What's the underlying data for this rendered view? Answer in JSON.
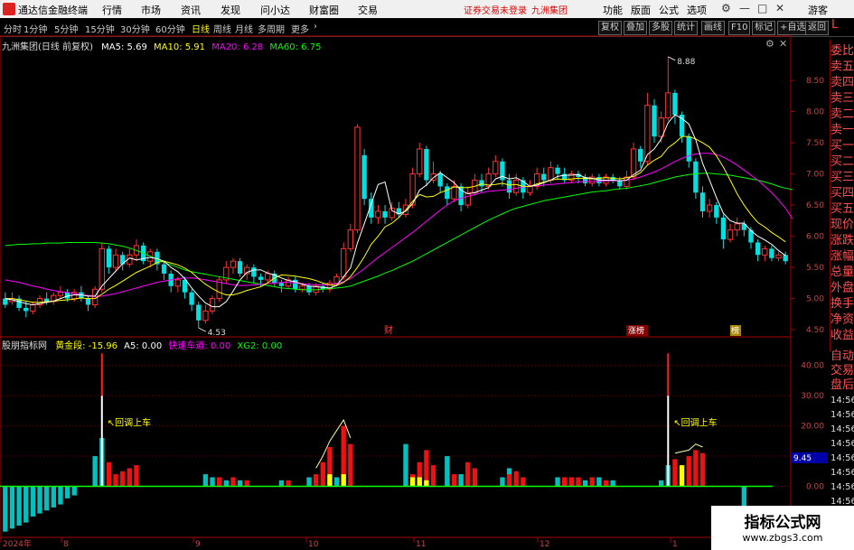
{
  "app": {
    "title": "通达信金融终端",
    "login_warning": "证券交易未登录",
    "stock_name": "九洲集团"
  },
  "menu": {
    "items": [
      "行情",
      "市场",
      "资讯",
      "发现",
      "问小达",
      "财富圈",
      "交易"
    ],
    "right": [
      "功能",
      "版面",
      "公式",
      "选项"
    ],
    "guest": "游客"
  },
  "toolbar": {
    "periods": [
      "分时",
      "1分钟",
      "5分钟",
      "15分钟",
      "30分钟",
      "60分钟",
      "日线",
      "周线",
      "月线",
      "多周期",
      "更多"
    ],
    "active": "日线",
    "right_buttons": [
      "复权",
      "叠加",
      "多股",
      "统计",
      "画线",
      "F10",
      "标记",
      "+自选",
      "返回"
    ]
  },
  "main_legend": {
    "stock": "九洲集团(日线 前复权)",
    "ma5": "MA5: 5.69",
    "ma10": "MA10: 5.91",
    "ma20": "MA20: 6.28",
    "ma60": "MA60: 6.75"
  },
  "sub_legend": {
    "name": "股朋指标网",
    "gold": "黄金段: -15.96",
    "a5": "A5: 0.00",
    "fast": "快速车道: 0.00",
    "xg2": "XG2: 0.00"
  },
  "side_panel": {
    "items": [
      "委比",
      "卖五",
      "卖四",
      "卖三",
      "卖二",
      "卖一",
      "买一",
      "买二",
      "买三",
      "买四",
      "买五",
      "现价",
      "涨跌",
      "涨幅",
      "总量",
      "外盘",
      "换手",
      "净资",
      "收益"
    ],
    "marker": "L"
  },
  "side_panel2": {
    "items": [
      "自动",
      "交易",
      "盘后",
      "14:56",
      "14:56",
      "14:56",
      "14:56",
      "14:56",
      "14:56",
      "14:56",
      "14:56",
      "14:56"
    ]
  },
  "price_axis": [
    "8.50",
    "8.00",
    "7.50",
    "7.00",
    "6.50",
    "6.00",
    "5.50",
    "5.00",
    "4.50"
  ],
  "sub_axis": [
    "40.00",
    "30.00",
    "20.00",
    "10.00",
    "0.00"
  ],
  "sub_marker": "9.45",
  "date_axis": [
    "2024年",
    "8",
    "9",
    "10",
    "11",
    "12",
    "1"
  ],
  "annotations": {
    "high": "8.88",
    "low": "4.53",
    "signal": "回调上车",
    "tag_cai": "财",
    "tag_zt": "涨榜",
    "tag_ban": "榜"
  },
  "watermark": {
    "line1": "指标公式网",
    "line2": "www.zbgs3.com"
  },
  "colors": {
    "up": "#ff3333",
    "down": "#00e0e0",
    "ma5": "#ffffff",
    "ma10": "#ffff00",
    "ma20": "#ff00ff",
    "ma60": "#00ff00"
  },
  "chart_data": {
    "type": "candlestick",
    "ylim": [
      4.4,
      8.95
    ],
    "candles": [
      [
        5.0,
        4.9,
        5.1,
        4.85
      ],
      [
        4.95,
        5.0,
        5.1,
        4.9
      ],
      [
        5.0,
        4.85,
        5.05,
        4.8
      ],
      [
        4.85,
        4.8,
        4.95,
        4.7
      ],
      [
        4.8,
        4.9,
        4.95,
        4.75
      ],
      [
        4.9,
        5.0,
        5.05,
        4.85
      ],
      [
        5.0,
        4.95,
        5.1,
        4.9
      ],
      [
        4.95,
        5.05,
        5.1,
        4.9
      ],
      [
        5.05,
        5.1,
        5.2,
        5.0
      ],
      [
        5.1,
        5.0,
        5.15,
        4.95
      ],
      [
        5.0,
        5.1,
        5.15,
        4.95
      ],
      [
        5.1,
        5.0,
        5.2,
        4.95
      ],
      [
        5.0,
        4.9,
        5.05,
        4.8
      ],
      [
        4.9,
        5.15,
        5.2,
        4.85
      ],
      [
        5.15,
        5.8,
        5.9,
        5.1
      ],
      [
        5.8,
        5.5,
        5.85,
        5.4
      ],
      [
        5.5,
        5.7,
        5.8,
        5.45
      ],
      [
        5.7,
        5.55,
        5.75,
        5.45
      ],
      [
        5.55,
        5.7,
        5.8,
        5.5
      ],
      [
        5.7,
        5.85,
        5.95,
        5.6
      ],
      [
        5.85,
        5.6,
        5.9,
        5.55
      ],
      [
        5.6,
        5.75,
        5.8,
        5.5
      ],
      [
        5.75,
        5.55,
        5.8,
        5.45
      ],
      [
        5.55,
        5.4,
        5.6,
        5.3
      ],
      [
        5.4,
        5.2,
        5.45,
        5.1
      ],
      [
        5.2,
        5.3,
        5.35,
        5.1
      ],
      [
        5.3,
        5.1,
        5.35,
        5.0
      ],
      [
        5.1,
        4.9,
        5.15,
        4.8
      ],
      [
        4.9,
        4.65,
        4.95,
        4.53
      ],
      [
        4.65,
        4.8,
        4.9,
        4.6
      ],
      [
        4.8,
        5.0,
        5.05,
        4.75
      ],
      [
        5.0,
        5.3,
        5.35,
        4.95
      ],
      [
        5.3,
        5.5,
        5.6,
        5.25
      ],
      [
        5.5,
        5.6,
        5.65,
        5.4
      ],
      [
        5.6,
        5.4,
        5.65,
        5.35
      ],
      [
        5.4,
        5.5,
        5.55,
        5.3
      ],
      [
        5.5,
        5.35,
        5.55,
        5.25
      ],
      [
        5.35,
        5.3,
        5.4,
        5.2
      ],
      [
        5.3,
        5.4,
        5.45,
        5.25
      ],
      [
        5.4,
        5.25,
        5.45,
        5.2
      ],
      [
        5.25,
        5.2,
        5.3,
        5.1
      ],
      [
        5.2,
        5.3,
        5.35,
        5.15
      ],
      [
        5.3,
        5.15,
        5.35,
        5.1
      ],
      [
        5.15,
        5.2,
        5.25,
        5.1
      ],
      [
        5.2,
        5.1,
        5.25,
        5.05
      ],
      [
        5.1,
        5.2,
        5.25,
        5.05
      ],
      [
        5.2,
        5.15,
        5.25,
        5.1
      ],
      [
        5.15,
        5.25,
        5.3,
        5.1
      ],
      [
        5.25,
        5.35,
        5.4,
        5.2
      ],
      [
        5.35,
        5.8,
        5.9,
        5.3
      ],
      [
        5.8,
        6.1,
        6.2,
        5.75
      ],
      [
        6.1,
        7.75,
        7.8,
        6.05
      ],
      [
        7.3,
        6.6,
        7.4,
        6.5
      ],
      [
        6.6,
        6.3,
        6.7,
        6.2
      ],
      [
        6.3,
        6.4,
        6.5,
        6.2
      ],
      [
        6.4,
        6.3,
        6.5,
        6.2
      ],
      [
        6.3,
        6.45,
        6.55,
        6.25
      ],
      [
        6.45,
        6.35,
        6.55,
        6.3
      ],
      [
        6.35,
        6.5,
        6.6,
        6.3
      ],
      [
        6.5,
        7.0,
        7.1,
        6.45
      ],
      [
        7.0,
        7.4,
        7.5,
        6.95
      ],
      [
        7.4,
        6.9,
        7.45,
        6.8
      ],
      [
        6.9,
        7.0,
        7.2,
        6.85
      ],
      [
        7.0,
        6.8,
        7.05,
        6.7
      ],
      [
        6.8,
        6.6,
        6.85,
        6.5
      ],
      [
        6.6,
        6.8,
        6.9,
        6.55
      ],
      [
        6.8,
        6.5,
        6.85,
        6.4
      ],
      [
        6.5,
        6.7,
        6.8,
        6.45
      ],
      [
        6.7,
        6.9,
        7.0,
        6.65
      ],
      [
        6.9,
        6.8,
        7.0,
        6.7
      ],
      [
        6.8,
        7.0,
        7.1,
        6.75
      ],
      [
        7.0,
        7.2,
        7.3,
        6.95
      ],
      [
        7.2,
        6.9,
        7.25,
        6.8
      ],
      [
        6.9,
        6.7,
        7.0,
        6.6
      ],
      [
        6.7,
        6.9,
        7.0,
        6.65
      ],
      [
        6.9,
        6.7,
        6.95,
        6.6
      ],
      [
        6.7,
        6.8,
        6.9,
        6.65
      ],
      [
        6.8,
        7.0,
        7.1,
        6.75
      ],
      [
        7.0,
        6.9,
        7.1,
        6.8
      ],
      [
        6.9,
        7.1,
        7.2,
        6.85
      ],
      [
        7.1,
        7.0,
        7.15,
        6.9
      ],
      [
        7.0,
        6.9,
        7.1,
        6.85
      ],
      [
        6.9,
        7.0,
        7.05,
        6.85
      ],
      [
        7.0,
        6.95,
        7.05,
        6.85
      ],
      [
        6.95,
        6.85,
        7.0,
        6.8
      ],
      [
        6.85,
        6.95,
        7.0,
        6.8
      ],
      [
        6.95,
        6.85,
        7.0,
        6.8
      ],
      [
        6.85,
        6.95,
        7.0,
        6.8
      ],
      [
        6.95,
        6.9,
        7.0,
        6.85
      ],
      [
        6.9,
        6.8,
        6.95,
        6.75
      ],
      [
        6.8,
        6.95,
        7.05,
        6.75
      ],
      [
        6.95,
        7.4,
        7.5,
        6.9
      ],
      [
        7.4,
        7.2,
        7.45,
        7.1
      ],
      [
        7.2,
        8.1,
        8.3,
        7.15
      ],
      [
        8.1,
        7.6,
        8.2,
        7.5
      ],
      [
        7.6,
        7.9,
        8.0,
        7.5
      ],
      [
        7.9,
        8.3,
        8.88,
        7.85
      ],
      [
        8.3,
        7.95,
        8.35,
        7.8
      ],
      [
        7.95,
        7.6,
        8.0,
        7.5
      ],
      [
        7.6,
        7.2,
        7.65,
        7.1
      ],
      [
        7.2,
        6.7,
        7.25,
        6.6
      ],
      [
        6.7,
        6.4,
        6.8,
        6.3
      ],
      [
        6.4,
        6.5,
        6.6,
        6.3
      ],
      [
        6.5,
        6.3,
        6.55,
        6.2
      ],
      [
        6.3,
        5.95,
        6.35,
        5.8
      ],
      [
        5.95,
        6.1,
        6.2,
        5.9
      ],
      [
        6.1,
        6.2,
        6.3,
        6.0
      ],
      [
        6.2,
        6.1,
        6.25,
        6.0
      ],
      [
        6.1,
        5.9,
        6.15,
        5.8
      ],
      [
        5.9,
        5.7,
        5.95,
        5.6
      ],
      [
        5.7,
        5.8,
        5.85,
        5.6
      ],
      [
        5.8,
        5.65,
        5.85,
        5.6
      ],
      [
        5.65,
        5.7,
        5.75,
        5.6
      ],
      [
        5.7,
        5.6,
        5.75,
        5.55
      ]
    ],
    "ma5": [
      5.0,
      4.98,
      4.95,
      4.92,
      4.9,
      4.92,
      4.94,
      4.96,
      5.0,
      5.04,
      5.06,
      5.06,
      5.04,
      5.04,
      5.2,
      5.32,
      5.44,
      5.56,
      5.65,
      5.62,
      5.64,
      5.66,
      5.64,
      5.6,
      5.5,
      5.43,
      5.32,
      5.17,
      5.04,
      4.93,
      4.87,
      4.87,
      4.95,
      5.12,
      5.3,
      5.42,
      5.46,
      5.46,
      5.41,
      5.38,
      5.33,
      5.29,
      5.27,
      5.23,
      5.2,
      5.19,
      5.18,
      5.17,
      5.21,
      5.35,
      5.49,
      5.89,
      6.2,
      6.52,
      6.83,
      6.87,
      6.41,
      6.36,
      6.4,
      6.52,
      6.74,
      6.82,
      6.94,
      7.02,
      6.94,
      6.86,
      6.74,
      6.68,
      6.7,
      6.74,
      6.78,
      6.92,
      6.96,
      6.92,
      6.94,
      6.88,
      6.8,
      6.82,
      6.86,
      6.9,
      6.96,
      6.98,
      6.98,
      6.99,
      6.94,
      6.93,
      6.9,
      6.9,
      6.9,
      6.89,
      6.9,
      6.99,
      7.06,
      7.31,
      7.4,
      7.56,
      7.82,
      7.95,
      7.89,
      7.8,
      7.55,
      7.17,
      6.9,
      6.62,
      6.37,
      6.25,
      6.21,
      6.21,
      6.09,
      6.0,
      5.94,
      5.87,
      5.77,
      5.69
    ],
    "ma10": [
      5.0,
      5.0,
      4.98,
      4.96,
      4.94,
      4.94,
      4.95,
      4.96,
      4.97,
      4.98,
      4.99,
      5.01,
      5.0,
      5.0,
      5.07,
      5.15,
      5.21,
      5.28,
      5.35,
      5.42,
      5.47,
      5.52,
      5.58,
      5.6,
      5.57,
      5.54,
      5.49,
      5.42,
      5.32,
      5.23,
      5.16,
      5.1,
      5.06,
      5.06,
      5.09,
      5.13,
      5.16,
      5.19,
      5.25,
      5.33,
      5.38,
      5.37,
      5.36,
      5.34,
      5.32,
      5.29,
      5.25,
      5.22,
      5.21,
      5.26,
      5.35,
      5.5,
      5.67,
      5.87,
      6.0,
      6.15,
      6.21,
      6.3,
      6.42,
      6.56,
      6.67,
      6.63,
      6.64,
      6.7,
      6.74,
      6.79,
      6.78,
      6.78,
      6.8,
      6.84,
      6.82,
      6.83,
      6.85,
      6.82,
      6.83,
      6.8,
      6.8,
      6.84,
      6.87,
      6.9,
      6.92,
      6.91,
      6.92,
      6.93,
      6.93,
      6.92,
      6.93,
      6.94,
      6.93,
      6.92,
      6.94,
      6.96,
      7.02,
      7.14,
      7.22,
      7.28,
      7.42,
      7.5,
      7.6,
      7.6,
      7.56,
      7.5,
      7.43,
      7.29,
      7.11,
      6.9,
      6.68,
      6.5,
      6.35,
      6.22,
      6.15,
      6.06,
      5.99,
      5.91
    ],
    "ma20": [
      5.3,
      5.28,
      5.26,
      5.23,
      5.2,
      5.18,
      5.15,
      5.13,
      5.11,
      5.1,
      5.08,
      5.06,
      5.05,
      5.03,
      5.04,
      5.06,
      5.08,
      5.11,
      5.14,
      5.17,
      5.2,
      5.23,
      5.26,
      5.28,
      5.3,
      5.32,
      5.33,
      5.33,
      5.32,
      5.3,
      5.28,
      5.26,
      5.24,
      5.22,
      5.21,
      5.21,
      5.22,
      5.23,
      5.24,
      5.25,
      5.26,
      5.26,
      5.25,
      5.24,
      5.23,
      5.22,
      5.22,
      5.22,
      5.24,
      5.27,
      5.32,
      5.4,
      5.48,
      5.57,
      5.66,
      5.74,
      5.82,
      5.9,
      5.98,
      6.06,
      6.15,
      6.24,
      6.33,
      6.42,
      6.5,
      6.57,
      6.61,
      6.64,
      6.67,
      6.7,
      6.72,
      6.73,
      6.74,
      6.75,
      6.77,
      6.79,
      6.8,
      6.81,
      6.82,
      6.83,
      6.84,
      6.85,
      6.86,
      6.87,
      6.88,
      6.88,
      6.88,
      6.89,
      6.89,
      6.89,
      6.9,
      6.92,
      6.95,
      6.99,
      7.03,
      7.08,
      7.14,
      7.2,
      7.25,
      7.29,
      7.32,
      7.33,
      7.33,
      7.31,
      7.27,
      7.21,
      7.14,
      7.06,
      6.98,
      6.9,
      6.8,
      6.7,
      6.58,
      6.45,
      6.28
    ],
    "ma60": [
      5.85,
      5.86,
      5.87,
      5.87,
      5.88,
      5.88,
      5.89,
      5.89,
      5.89,
      5.9,
      5.9,
      5.9,
      5.9,
      5.9,
      5.89,
      5.88,
      5.86,
      5.84,
      5.81,
      5.77,
      5.73,
      5.68,
      5.63,
      5.58,
      5.54,
      5.5,
      5.46,
      5.43,
      5.41,
      5.39,
      5.37,
      5.35,
      5.33,
      5.31,
      5.29,
      5.27,
      5.25,
      5.23,
      5.21,
      5.19,
      5.17,
      5.16,
      5.15,
      5.14,
      5.14,
      5.14,
      5.15,
      5.16,
      5.17,
      5.18,
      5.2,
      5.24,
      5.28,
      5.32,
      5.36,
      5.41,
      5.45,
      5.5,
      5.55,
      5.6,
      5.66,
      5.72,
      5.78,
      5.84,
      5.9,
      5.96,
      6.02,
      6.08,
      6.14,
      6.2,
      6.26,
      6.31,
      6.36,
      6.41,
      6.45,
      6.48,
      6.51,
      6.54,
      6.57,
      6.59,
      6.61,
      6.63,
      6.65,
      6.67,
      6.69,
      6.71,
      6.72,
      6.73,
      6.75,
      6.76,
      6.77,
      6.79,
      6.81,
      6.83,
      6.86,
      6.89,
      6.92,
      6.95,
      6.97,
      6.99,
      7.0,
      7.01,
      7.01,
      7.0,
      6.99,
      6.98,
      6.96,
      6.94,
      6.92,
      6.9,
      6.87,
      6.84,
      6.8,
      6.77,
      6.75
    ]
  },
  "sub_chart_data": {
    "type": "bar",
    "ylim": [
      -16,
      45
    ],
    "cyan_bars": [
      [
        0,
        -15
      ],
      [
        1,
        -14
      ],
      [
        2,
        -13
      ],
      [
        3,
        -12
      ],
      [
        4,
        -10
      ],
      [
        5,
        -9
      ],
      [
        6,
        -8
      ],
      [
        7,
        -7
      ],
      [
        8,
        -6
      ],
      [
        9,
        -4
      ],
      [
        10,
        -3
      ],
      [
        13,
        10
      ],
      [
        14,
        16
      ],
      [
        29,
        4
      ],
      [
        30,
        3
      ],
      [
        32,
        2
      ],
      [
        34,
        2
      ],
      [
        40,
        2
      ],
      [
        44,
        3
      ],
      [
        48,
        3
      ],
      [
        58,
        14
      ],
      [
        64,
        10
      ],
      [
        66,
        4
      ],
      [
        72,
        3
      ],
      [
        73,
        6
      ],
      [
        80,
        3
      ],
      [
        84,
        2
      ],
      [
        86,
        3
      ],
      [
        88,
        2
      ],
      [
        95,
        2
      ],
      [
        96,
        7
      ],
      [
        107,
        -9
      ]
    ],
    "red_bars": [
      [
        15,
        8
      ],
      [
        16,
        4
      ],
      [
        17,
        5
      ],
      [
        18,
        6
      ],
      [
        19,
        7
      ],
      [
        31,
        3
      ],
      [
        33,
        3
      ],
      [
        35,
        2
      ],
      [
        41,
        2
      ],
      [
        45,
        4
      ],
      [
        46,
        8
      ],
      [
        47,
        13
      ],
      [
        49,
        20
      ],
      [
        50,
        14
      ],
      [
        59,
        4
      ],
      [
        60,
        8
      ],
      [
        61,
        12
      ],
      [
        62,
        7
      ],
      [
        65,
        4
      ],
      [
        67,
        8
      ],
      [
        68,
        6
      ],
      [
        73,
        4
      ],
      [
        74,
        5
      ],
      [
        75,
        3
      ],
      [
        81,
        3
      ],
      [
        82,
        3
      ],
      [
        83,
        3
      ],
      [
        85,
        3
      ],
      [
        87,
        2
      ],
      [
        97,
        9
      ],
      [
        99,
        10
      ],
      [
        100,
        12
      ],
      [
        101,
        11
      ]
    ],
    "yellow_bars": [
      [
        47,
        4
      ],
      [
        49,
        4
      ],
      [
        59,
        3
      ],
      [
        60,
        3
      ],
      [
        61,
        2
      ],
      [
        98,
        7
      ]
    ],
    "signal_bars": [
      [
        14,
        -1,
        44
      ],
      [
        96,
        -1,
        44
      ]
    ]
  }
}
